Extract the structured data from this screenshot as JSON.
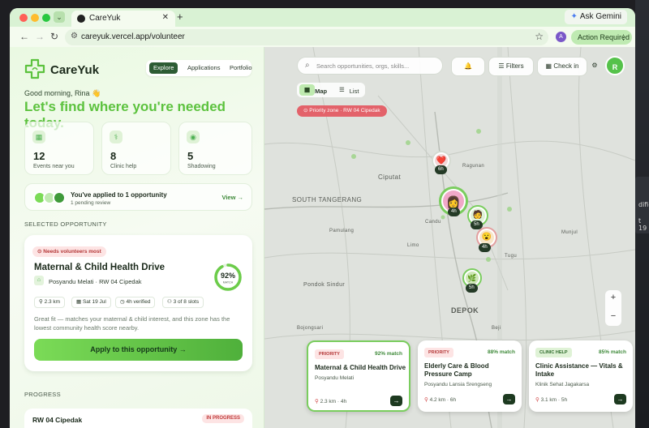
{
  "browser": {
    "tab_title": "CareYuk",
    "url": "careyuk.vercel.app/volunteer",
    "gemini_label": "Ask Gemini",
    "action_required": "Action Required",
    "profile_initial": "A"
  },
  "app": {
    "brand": "CareYuk",
    "nav": [
      "Explore",
      "Applications",
      "Portfolio"
    ],
    "greeting": "Good morning, Rina 👋",
    "headline": "Let's find where you're needed today.",
    "stats": [
      {
        "value": "12",
        "label": "Events near you",
        "icon": "calendar-icon"
      },
      {
        "value": "8",
        "label": "Clinic help",
        "icon": "stethoscope-icon"
      },
      {
        "value": "5",
        "label": "Shadowing",
        "icon": "eye-icon"
      }
    ],
    "applied": {
      "title": "You've applied to 1 opportunity",
      "subtitle": "1 pending review",
      "view": "View →"
    },
    "selected_label": "SELECTED OPPORTUNITY",
    "selected": {
      "badge": "Needs volunteers most",
      "title": "Maternal & Child Health Drive",
      "location": "Posyandu Melati · RW 04 Cipedak",
      "match": "92%",
      "match_label": "MATCH",
      "match_value": 0.92,
      "chips": [
        "2.3 km",
        "Sat 19 Jul",
        "4h verified",
        "3 of 8 slots"
      ],
      "description": "Great fit — matches your maternal & child interest, and this zone has the lowest community health score nearby.",
      "apply": "Apply to this opportunity →"
    },
    "progress_label": "PROGRESS",
    "progress": {
      "name": "RW 04 Cipedak",
      "status": "IN PROGRESS"
    }
  },
  "map": {
    "search_placeholder": "Search opportunities, orgs, skills...",
    "filters": "Filters",
    "check_in": "Check in",
    "avatar_initial": "R",
    "view_tabs": [
      "Map",
      "List"
    ],
    "priority_zone": "Priority zone · RW 04 Cipedak",
    "place_labels": [
      "Ciputat",
      "SOUTH TANGERANG",
      "DEPOK",
      "Ragunan",
      "Candu",
      "Limo",
      "Pondok Sindur",
      "Pamulang",
      "Bojongsari",
      "Tugu",
      "Munjul",
      "Beji"
    ],
    "pins": [
      {
        "hours": "6h",
        "emoji": "❤️"
      },
      {
        "hours": "4h",
        "emoji": "👩"
      },
      {
        "hours": "5h",
        "emoji": "🧑"
      },
      {
        "hours": "4h",
        "emoji": "😮"
      },
      {
        "hours": "5h",
        "emoji": "🌿"
      }
    ],
    "cards": [
      {
        "tag": "PRIORITY",
        "match": "92% match",
        "title": "Maternal & Child Health Drive",
        "org": "Posyandu Melati",
        "meta": "2.3 km · 4h"
      },
      {
        "tag": "PRIORITY",
        "match": "88% match",
        "title": "Elderly Care & Blood Pressure Camp",
        "org": "Posyandu Lansia Srengseng",
        "meta": "4.2 km · 6h"
      },
      {
        "tag": "CLINIC HELP",
        "match": "85% match",
        "title": "Clinic Assistance — Vitals & Intake",
        "org": "Klinik Sehat Jagakarsa",
        "meta": "3.1 km · 5h"
      }
    ]
  },
  "desktop_peek": [
    "dified",
    "t 19"
  ],
  "colors": {
    "accent": "#5cc23e",
    "dark_green": "#2d5c34",
    "priority_red": "#e3626a"
  }
}
